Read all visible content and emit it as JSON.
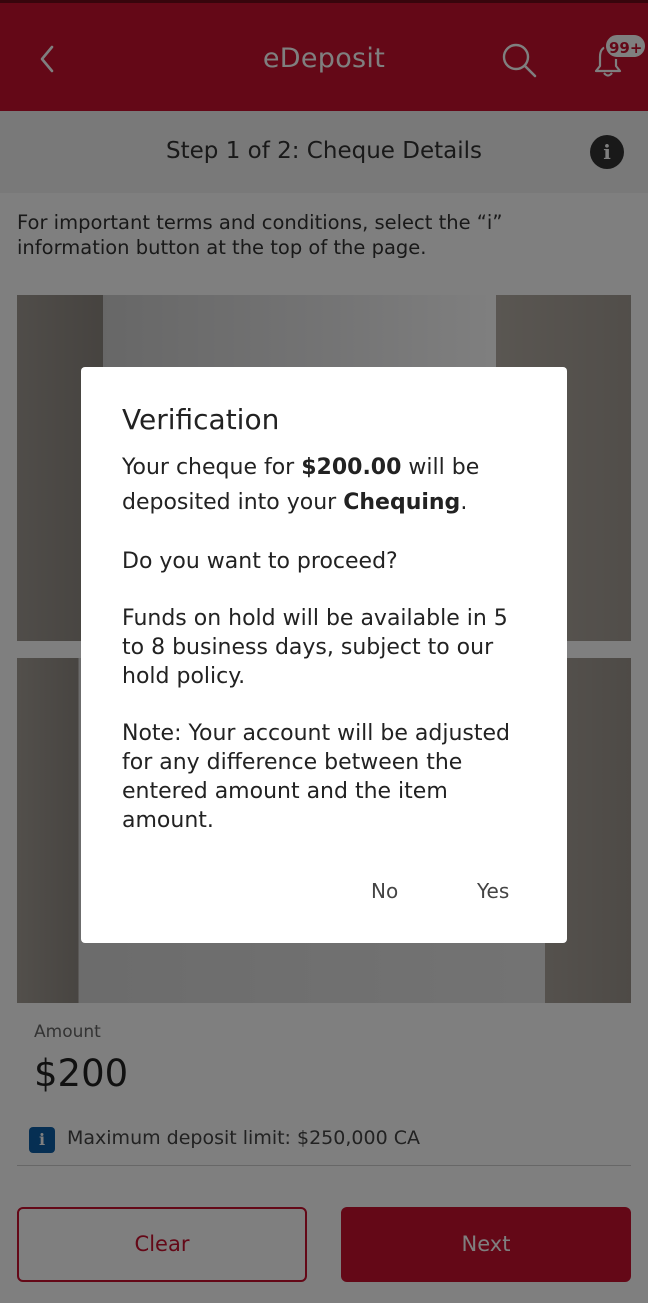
{
  "header": {
    "title": "eDeposit",
    "badge": "99+"
  },
  "stepbar": {
    "text": "Step 1 of 2: Cheque Details",
    "info_glyph": "i"
  },
  "terms_text": "For important terms and conditions, select the “i” information button at the top of the page.",
  "form": {
    "amount_label": "Amount",
    "amount_value": "$200",
    "limit_glyph": "i",
    "limit_text": "Maximum deposit limit: $250,000 CA"
  },
  "buttons": {
    "clear": "Clear",
    "next": "Next"
  },
  "dialog": {
    "title": "Verification",
    "line1_a": "Your cheque for ",
    "line1_amount": "$200.00",
    "line1_b": " will be deposited into your ",
    "line1_account": "Chequing",
    "line1_c": ".",
    "question": "Do you want to proceed?",
    "funds_note": "Funds on hold will be available in 5 to 8 business days, subject to our hold policy.",
    "adjust_note": "Note: Your account will be adjusted for any difference between the entered amount and the item amount.",
    "no": "No",
    "yes": "Yes"
  },
  "icons": {
    "back": "chevron-left-icon",
    "search": "search-icon",
    "bell": "bell-icon",
    "info": "info-icon"
  },
  "colors": {
    "brand": "#c8102e",
    "info_blue": "#0d5fa6"
  }
}
